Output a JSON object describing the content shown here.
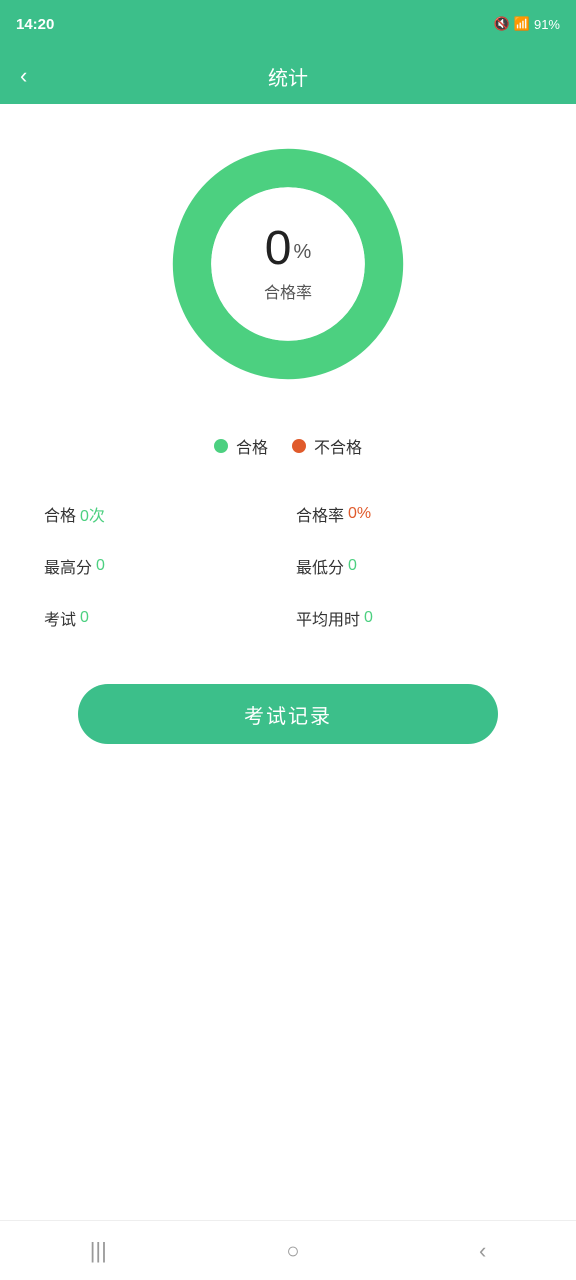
{
  "statusBar": {
    "time": "14:20",
    "battery": "91%"
  },
  "navBar": {
    "title": "统计",
    "backLabel": "‹"
  },
  "chart": {
    "percentage": "0",
    "percentSign": "%",
    "label": "合格率",
    "ringColor": "#4cd080",
    "bgColor": "#e8e8e8"
  },
  "legend": {
    "pass": "合格",
    "fail": "不合格"
  },
  "stats": [
    {
      "label": "合格",
      "value": "0次",
      "valueColor": "green",
      "side": "left"
    },
    {
      "label": "合格率",
      "value": "0%",
      "valueColor": "orange",
      "side": "right"
    },
    {
      "label": "最高分",
      "value": "0",
      "valueColor": "green",
      "side": "left"
    },
    {
      "label": "最低分",
      "value": "0",
      "valueColor": "green",
      "side": "right"
    },
    {
      "label": "考试",
      "value": "0",
      "valueColor": "green",
      "side": "left"
    },
    {
      "label": "平均用时",
      "value": "0",
      "valueColor": "green",
      "side": "right"
    }
  ],
  "button": {
    "examRecords": "考试记录"
  },
  "bottomNav": {
    "items": [
      "|||",
      "○",
      "‹"
    ]
  }
}
